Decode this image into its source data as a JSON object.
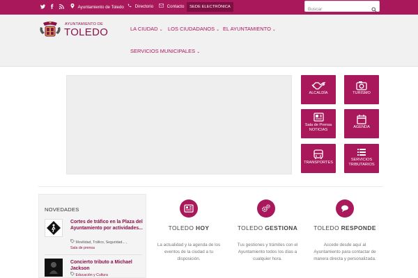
{
  "topbar": {
    "social": [
      {
        "name": "twitter-icon",
        "glyph": "t"
      },
      {
        "name": "facebook-icon",
        "glyph": "f"
      },
      {
        "name": "rss-icon",
        "glyph": "≈"
      }
    ],
    "links": [
      {
        "icon": "●",
        "label": "Ayuntamiento de Toledo"
      },
      {
        "icon": "☎",
        "label": "Directorio"
      },
      {
        "icon": "✉",
        "label": "Contacto"
      }
    ],
    "sede_label": "SEDE ELECTRÓNICA",
    "search_placeholder": "Buscar"
  },
  "logo": {
    "small": "AYUNTAMIENTO DE",
    "big": "TOLEDO"
  },
  "nav": [
    {
      "label": "LA CIUDAD"
    },
    {
      "label": "LOS CIUDADANOS"
    },
    {
      "label": "EL AYUNTAMIENTO"
    },
    {
      "label": "SERVICIOS MUNICIPALES"
    }
  ],
  "nav_chevron": "⌄",
  "tiles": [
    {
      "label_top": "",
      "label": "ALCALDÍA",
      "icon": "handshake-icon"
    },
    {
      "label_top": "",
      "label": "TURISMO",
      "icon": "camera-icon"
    },
    {
      "label_top": "Sala de Prensa",
      "label": "NOTICIAS",
      "icon": "newspaper-icon"
    },
    {
      "label_top": "",
      "label": "AGENDA",
      "icon": "calendar-icon"
    },
    {
      "label_top": "",
      "label": "TRANSPORTES",
      "icon": "bus-icon"
    },
    {
      "label_top": "SERVICIOS",
      "label": "TRIBUTARIOS",
      "icon": "list-icon"
    }
  ],
  "news": {
    "title": "NOVEDADES",
    "items": [
      {
        "title": "Cortes de tráfico en la Plaza del Ayuntamiento por actividades...",
        "meta1": "Movilidad, Tráfico, Seguridad... ,",
        "meta2": "Sala de prensa",
        "img_caption": "TOLEDO"
      },
      {
        "title": "Concierto tributo a Michael Jackson",
        "meta1": "Educación y Cultura",
        "meta2": "",
        "img_caption": "MICHAEL"
      }
    ]
  },
  "cards": [
    {
      "title_a": "TOLEDO ",
      "title_b": "HOY",
      "text": "La actualidad y la agenda de los eventos de la ciudad a tu disposición.",
      "icon": "newspaper-icon"
    },
    {
      "title_a": "TOLEDO ",
      "title_b": "GESTIONA",
      "text": "Tus gestiones y trámites con el Ayuntamiento todos los días a cualquier hora.",
      "icon": "gears-icon"
    },
    {
      "title_a": "TOLEDO ",
      "title_b": "RESPONDE",
      "text": "Accede desde aquí al Ayuntamiento para contactar de manera directa y personalizada.",
      "icon": "chat-bubble-icon"
    }
  ],
  "colors": {
    "brand": "#a8185a",
    "brand_dark": "#7d0f42",
    "header_bg": "#f1f1f1",
    "slider_bg": "#eeeeee"
  }
}
